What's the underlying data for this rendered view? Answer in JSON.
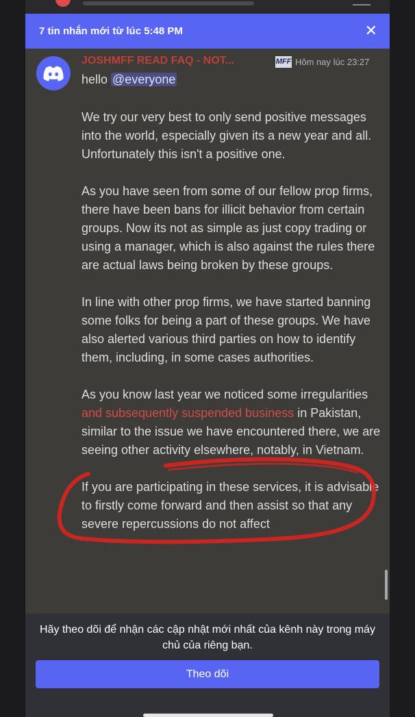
{
  "banner": {
    "text": "7 tin nhắn mới từ lúc 5:48 PM",
    "close_glyph": "✕"
  },
  "message": {
    "author": "JOSHMFF READ FAQ - NOT...",
    "author_color": "#e8403a",
    "badge": "MFF",
    "timestamp": "Hôm nay lúc 23:27",
    "greeting": "hello ",
    "mention": "@everyone",
    "paragraphs": {
      "p1": "We try our very best to only send positive messages into the world, especially given its a new year and all. Unfortunately this isn't a positive one.",
      "p2": "As you have seen from some of our fellow prop firms, there have been bans for illicit behavior from certain groups. Now its not as simple as just copy trading or using a manager, which is also against the rules there are actual laws being broken by these groups.",
      "p3": "In line with other prop firms, we have started banning some folks for being a part of these groups. We have also alerted various third parties on how to identify them, including, in some cases authorities.",
      "p4a": "As you know last year we noticed some irregularities ",
      "p4b": "and subsequently suspended business",
      "p4c": " in Pakistan, similar to the issue we have encountered there, we are seeing other activity elsewhere, notably, in Vietnam.",
      "p5": "If you are participating in these services, it is advisable to firstly come forward  and then assist so that any severe repercussions do not affect"
    }
  },
  "follow": {
    "prompt": "Hãy theo dõi để nhận các cập nhật mới nhất của kênh này trong máy chủ của riêng bạn.",
    "button_label": "Theo dõi"
  },
  "colors": {
    "accent": "#5865f2",
    "annotation": "#d8231f"
  },
  "icons": {
    "avatar": "discord-logo-icon",
    "close": "close-icon"
  }
}
